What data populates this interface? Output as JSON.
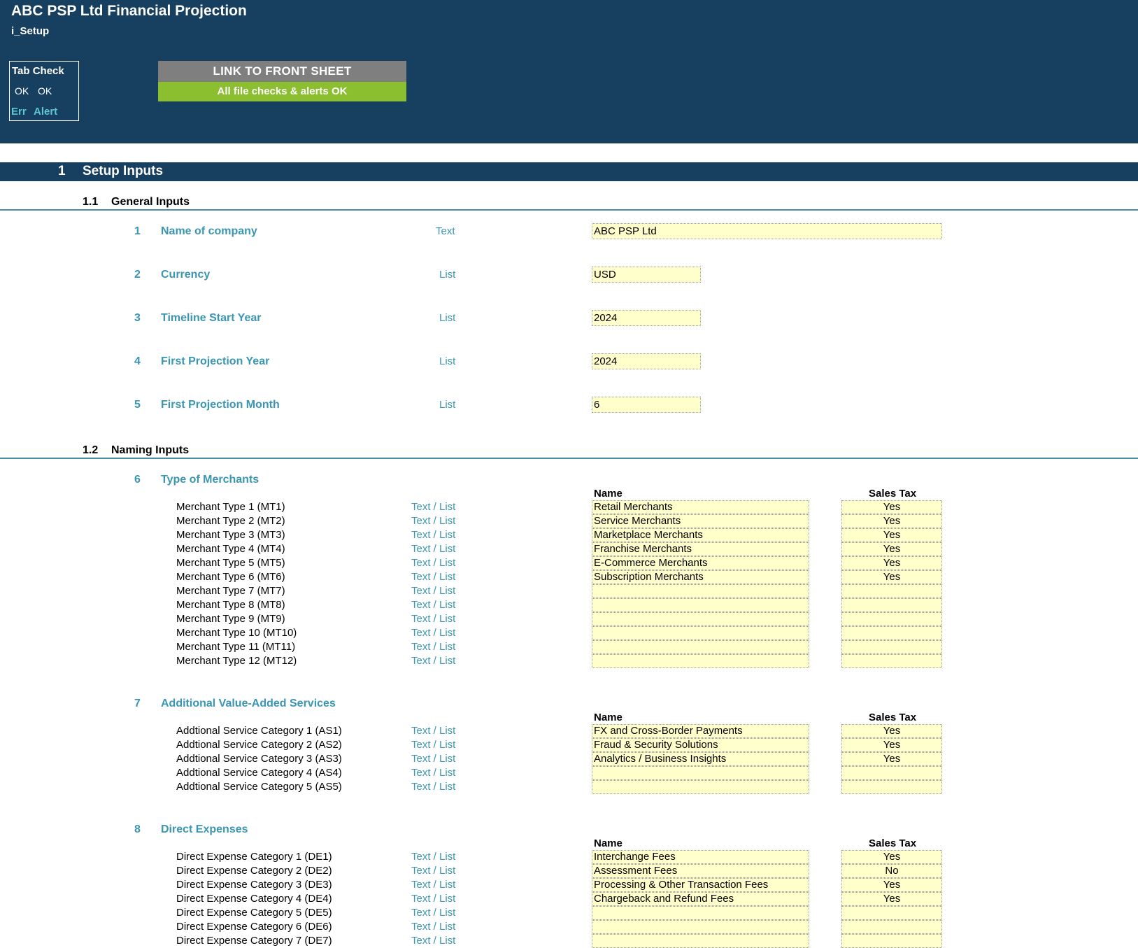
{
  "header": {
    "title": "ABC PSP Ltd Financial Projection",
    "sheet": "i_Setup",
    "tab_check": {
      "title": "Tab Check",
      "ok1": "OK",
      "ok2": "OK",
      "err": "Err",
      "alert": "Alert"
    },
    "link_button": "LINK TO FRONT SHEET",
    "status": "All file checks & alerts OK"
  },
  "section": {
    "number": "1",
    "title": "Setup Inputs"
  },
  "general": {
    "number": "1.1",
    "title": "General Inputs",
    "items": [
      {
        "num": "1",
        "label": "Name of company",
        "type": "Text",
        "value": "ABC PSP Ltd"
      },
      {
        "num": "2",
        "label": "Currency",
        "type": "List",
        "value": "USD"
      },
      {
        "num": "3",
        "label": "Timeline Start Year",
        "type": "List",
        "value": "2024"
      },
      {
        "num": "4",
        "label": "First Projection Year",
        "type": "List",
        "value": "2024"
      },
      {
        "num": "5",
        "label": "First Projection Month",
        "type": "List",
        "value": "6"
      }
    ]
  },
  "naming": {
    "number": "1.2",
    "title": "Naming Inputs",
    "col_name": "Name",
    "col_tax": "Sales Tax",
    "row_type": "Text / List",
    "groups": [
      {
        "num": "6",
        "label": "Type of Merchants",
        "rows": [
          {
            "label": "Merchant Type 1 (MT1)",
            "name": "Retail Merchants",
            "tax": "Yes"
          },
          {
            "label": "Merchant Type 2 (MT2)",
            "name": "Service Merchants",
            "tax": "Yes"
          },
          {
            "label": "Merchant Type 3 (MT3)",
            "name": "Marketplace Merchants",
            "tax": "Yes"
          },
          {
            "label": "Merchant Type 4 (MT4)",
            "name": "Franchise Merchants",
            "tax": "Yes"
          },
          {
            "label": "Merchant Type 5 (MT5)",
            "name": "E-Commerce Merchants",
            "tax": "Yes"
          },
          {
            "label": "Merchant Type 6 (MT6)",
            "name": "Subscription Merchants",
            "tax": "Yes"
          },
          {
            "label": "Merchant Type 7 (MT7)",
            "name": "",
            "tax": ""
          },
          {
            "label": "Merchant Type 8 (MT8)",
            "name": "",
            "tax": ""
          },
          {
            "label": "Merchant Type 9 (MT9)",
            "name": "",
            "tax": ""
          },
          {
            "label": "Merchant Type 10 (MT10)",
            "name": "",
            "tax": ""
          },
          {
            "label": "Merchant Type 11 (MT11)",
            "name": "",
            "tax": ""
          },
          {
            "label": "Merchant Type 12 (MT12)",
            "name": "",
            "tax": ""
          }
        ]
      },
      {
        "num": "7",
        "label": "Additional Value-Added Services",
        "rows": [
          {
            "label": "Addtional Service Category 1 (AS1)",
            "name": "FX and Cross-Border Payments",
            "tax": "Yes"
          },
          {
            "label": "Addtional Service Category 2 (AS2)",
            "name": "Fraud & Security Solutions",
            "tax": "Yes"
          },
          {
            "label": "Addtional Service Category 3 (AS3)",
            "name": "Analytics / Business Insights",
            "tax": "Yes"
          },
          {
            "label": "Addtional Service Category 4 (AS4)",
            "name": "",
            "tax": ""
          },
          {
            "label": "Addtional Service Category 5 (AS5)",
            "name": "",
            "tax": ""
          }
        ]
      },
      {
        "num": "8",
        "label": "Direct Expenses",
        "rows": [
          {
            "label": "Direct Expense Category 1 (DE1)",
            "name": "Interchange Fees",
            "tax": "Yes"
          },
          {
            "label": "Direct Expense Category 2 (DE2)",
            "name": "Assessment Fees",
            "tax": "No"
          },
          {
            "label": "Direct Expense Category 3 (DE3)",
            "name": "Processing & Other Transaction Fees",
            "tax": "Yes"
          },
          {
            "label": "Direct Expense Category 4 (DE4)",
            "name": "Chargeback and Refund Fees",
            "tax": "Yes"
          },
          {
            "label": "Direct Expense Category 5 (DE5)",
            "name": "",
            "tax": ""
          },
          {
            "label": "Direct Expense Category 6 (DE6)",
            "name": "",
            "tax": ""
          },
          {
            "label": "Direct Expense Category 7 (DE7)",
            "name": "",
            "tax": ""
          }
        ]
      }
    ]
  }
}
